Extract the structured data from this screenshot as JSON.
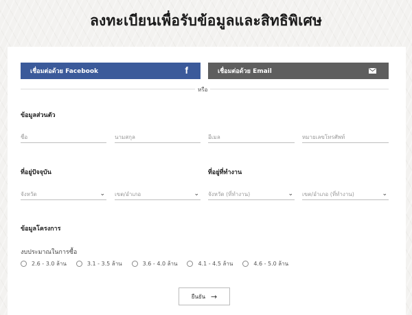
{
  "title": "ลงทะเบียนเพื่อรับข้อมูลและสิทธิพิเศษ",
  "social": {
    "facebook_label": "เชื่อมต่อด้วย Facebook",
    "facebook_icon": "f",
    "email_label": "เชื่อมต่อด้วย Email",
    "or_text": "หรือ",
    "facebook_color": "#3b5a9a",
    "email_color": "#5e5e5e"
  },
  "personal": {
    "section_label": "ข้อมูลส่วนตัว",
    "first_name_placeholder": "ชื่อ",
    "last_name_placeholder": "นามสกุล",
    "email_placeholder": "อีเมล",
    "phone_placeholder": "หมายเลขโทรศัพท์"
  },
  "address": {
    "home_label": "ที่อยู่ปัจจุบัน",
    "home_province": "จังหวัด",
    "home_district": "เขต/อำเภอ",
    "work_label": "ที่อยู่ที่ทำงาน",
    "work_province": "จังหวัด (ที่ทำงาน)",
    "work_district": "เขต/อำเภอ (ที่ทำงาน)"
  },
  "project": {
    "section_label": "ข้อมูลโครงการ",
    "budget_label": "งบประมาณในการซื้อ",
    "budget_options": [
      "2.6 - 3.0 ล้าน",
      "3.1 - 3.5 ล้าน",
      "3.6 - 4.0 ล้าน",
      "4.1 - 4.5 ล้าน",
      "4.6 - 5.0 ล้าน"
    ]
  },
  "submit": {
    "label": "ยืนยัน",
    "arrow": "→"
  },
  "icons": {
    "chevron": "⌄"
  }
}
